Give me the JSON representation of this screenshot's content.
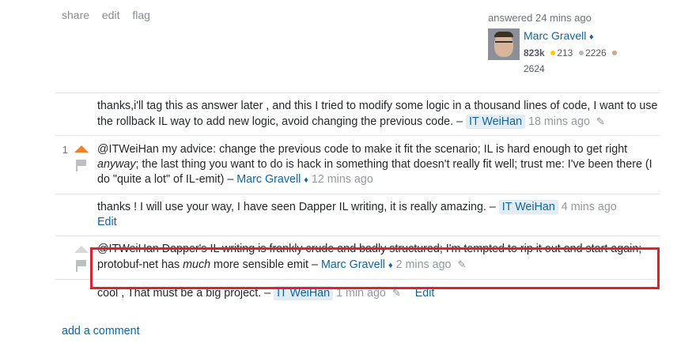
{
  "post_menu": {
    "share": "share",
    "edit": "edit",
    "flag": "flag"
  },
  "user_card": {
    "action": "answered 24 mins ago",
    "name": "Marc Gravell",
    "diamond": "♦",
    "reputation": "823k",
    "gold": "213",
    "silver": "2226",
    "bronze": "2624",
    "colors": {
      "gold": "#ffcc01",
      "silver": "#b4b8bc",
      "bronze": "#d1a684"
    }
  },
  "comments": [
    {
      "score": "",
      "text": "thanks,i'll tag this as answer later , and this I tried to modify some logic in a thousand lines of code, I want to use the rollback IL way to add new logic, avoid changing the previous code. –",
      "user": "IT WeiHan",
      "date": "18 mins ago"
    },
    {
      "score": "1",
      "text_pre": "@ITWeiHan my advice: change the previous code to make it fit the scenario; IL is hard enough to get right ",
      "text_em": "anyway",
      "text_post": "; the last thing you want to do is hack in something that doesn't really fit well; trust me: I've been there (I do \"quite a lot\" of IL-emit) –",
      "user": "Marc Gravell",
      "diamond": "♦",
      "date": "12 mins ago"
    },
    {
      "score": "",
      "text": "thanks ! I will use your way, I have seen Dapper IL writing, it is really amazing. –",
      "user": "IT WeiHan",
      "date": "4 mins ago",
      "edit": "Edit"
    },
    {
      "score": "",
      "text_pre": "@ITWeiHan Dapper's IL writing is frankly crude and badly structured; I'm tempted to rip it out and start again; protobuf-net has ",
      "text_em": "much",
      "text_post": " more sensible emit –",
      "user": "Marc Gravell",
      "diamond": "♦",
      "date": "2 mins ago"
    },
    {
      "score": "",
      "text": "cool , That must be a big project. –",
      "user": "IT WeiHan",
      "date": "1 min ago",
      "edit": "Edit"
    }
  ],
  "add_comment": "add a comment",
  "icons": {
    "edit": "pencil-icon",
    "upvote": "upvote-arrow-icon",
    "flag": "flag-icon"
  },
  "highlight_color": "#e0212b"
}
